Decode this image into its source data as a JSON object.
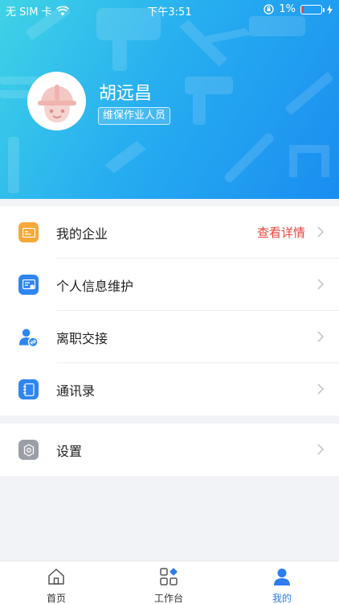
{
  "status_bar": {
    "carrier": "无 SIM 卡",
    "time": "下午3:51",
    "battery": "1%"
  },
  "profile": {
    "name": "胡远昌",
    "role": "维保作业人员"
  },
  "menu": [
    {
      "label": "我的企业",
      "extra": "查看详情",
      "icon": "company-card-icon",
      "color": "#f7a93a"
    },
    {
      "label": "个人信息维护",
      "icon": "id-card-icon",
      "color": "#2e86f0"
    },
    {
      "label": "离职交接",
      "icon": "person-swap-icon",
      "color": "#2e86f0"
    },
    {
      "label": "通讯录",
      "icon": "address-book-icon",
      "color": "#2e86f0"
    }
  ],
  "settings": {
    "label": "设置",
    "icon": "gear-icon",
    "color": "#9a9ea6"
  },
  "tabs": [
    {
      "label": "首页",
      "icon": "home-icon"
    },
    {
      "label": "工作台",
      "icon": "workbench-icon"
    },
    {
      "label": "我的",
      "icon": "profile-icon",
      "active": true
    }
  ],
  "colors": {
    "header_start": "#3fd3e6",
    "header_end": "#1a8df0",
    "accent": "#2d7cf0",
    "link_red": "#e8423b"
  }
}
